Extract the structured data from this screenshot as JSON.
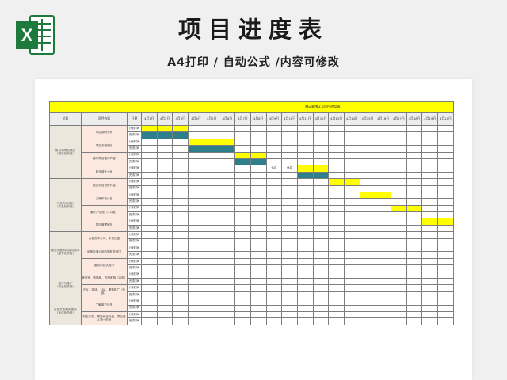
{
  "page": {
    "title": "项目进度表",
    "subtitle": "A4打印 / 自动公式 /内容可修改"
  },
  "app": {
    "icon": "excel-icon"
  },
  "colors": {
    "plan": "#ffff00",
    "done": "#2e7e8c",
    "banner": "#ffff00",
    "stage_bg": "#ebe7dc",
    "content_bg": "#fbe9df"
  },
  "sheet": {
    "banner": "移动端关2.0项目进度表",
    "headers": {
      "stage": "阶段",
      "content": "项目内容",
      "type": "日期"
    },
    "dates": [
      "4月1日",
      "4月2日",
      "4月3日",
      "4月4日",
      "4月5日",
      "4月6日",
      "4月7日",
      "4月8日",
      "4月9日",
      "4月10日",
      "4月11日",
      "4月12日",
      "4月13日",
      "4月14日",
      "4月15日",
      "4月16日",
      "4月17日",
      "4月18日",
      "4月19日",
      "4月20日"
    ],
    "type_plan": "计划时间",
    "type_done": "完成时间",
    "groups": [
      {
        "stage": "策划和项目确定\n（概念化阶段）",
        "tasks": [
          {
            "content": "项目调研分析",
            "plan": [
              1,
              3
            ],
            "done": [
              1,
              3
            ],
            "notes": []
          },
          {
            "content": "项目方案规划",
            "plan": [
              4,
              6
            ],
            "done": [
              4,
              6
            ],
            "notes": []
          },
          {
            "content": "编写项目整体内容",
            "plan": [
              7,
              8
            ],
            "done": [
              7,
              8
            ],
            "notes": []
          },
          {
            "content": "新长城大公司",
            "plan": [
              11,
              12
            ],
            "done": [
              11,
              12
            ],
            "notes": [
              {
                "day": 9,
                "text": "休息"
              },
              {
                "day": 10,
                "text": "休息"
              }
            ]
          }
        ]
      },
      {
        "stage": "产品方案设计\n（产品化阶段）",
        "tasks": [
          {
            "content": "验光项目进阶内容",
            "plan": [
              13,
              14
            ],
            "done": null,
            "notes": []
          },
          {
            "content": "方案和设计部",
            "plan": [
              15,
              16
            ],
            "done": null,
            "notes": []
          },
          {
            "content": "最小产品化（1.0版）",
            "plan": [
              17,
              18
            ],
            "done": null,
            "notes": []
          },
          {
            "content": "项目管理审批",
            "plan": [
              19,
              20
            ],
            "done": null,
            "notes": []
          }
        ]
      },
      {
        "stage": "服务流程和内容与技术\n（细节化阶段）",
        "tasks": [
          {
            "content": "合调去市公司、来设进度",
            "plan": null,
            "done": null,
            "notes": []
          },
          {
            "content": "间落协调公司内部相关部门",
            "plan": null,
            "done": null,
            "notes": []
          },
          {
            "content": "服务项目试运行",
            "plan": null,
            "done": null,
            "notes": []
          }
        ]
      },
      {
        "stage": "宣传与推广\n（商品化阶段）",
        "tasks": [
          {
            "content": "微信号、市场部、内部审核（内部）",
            "plan": null,
            "done": null,
            "notes": []
          },
          {
            "content": "正义、媒体、180、渠道推广（外部）",
            "plan": null,
            "done": null,
            "notes": []
          }
        ]
      },
      {
        "stage": "反馈并定制和迭代\n（优化化阶段）",
        "tasks": [
          {
            "content": "了解客户反馈",
            "plan": null,
            "done": null,
            "notes": []
          },
          {
            "content": "制定方案、更新优化升级、项目进入第一阶段",
            "plan": null,
            "done": null,
            "notes": []
          }
        ]
      }
    ]
  }
}
